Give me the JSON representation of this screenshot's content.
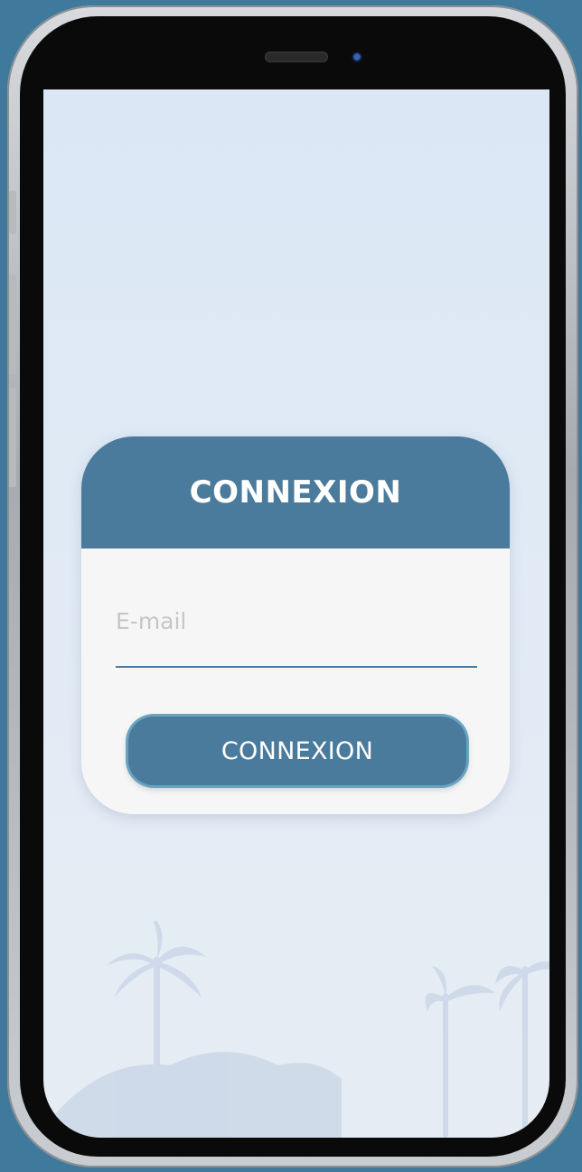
{
  "login": {
    "title": "CONNEXION",
    "email_placeholder": "E-mail",
    "email_value": "",
    "submit_label": "CONNEXION"
  },
  "colors": {
    "accent": "#4a7a9c",
    "screen_background": "#dfe9f5",
    "card_background": "#f6f6f6",
    "placeholder_text": "#c6c6c6"
  },
  "icons": {
    "background_decoration": "palm-trees-illustration"
  }
}
